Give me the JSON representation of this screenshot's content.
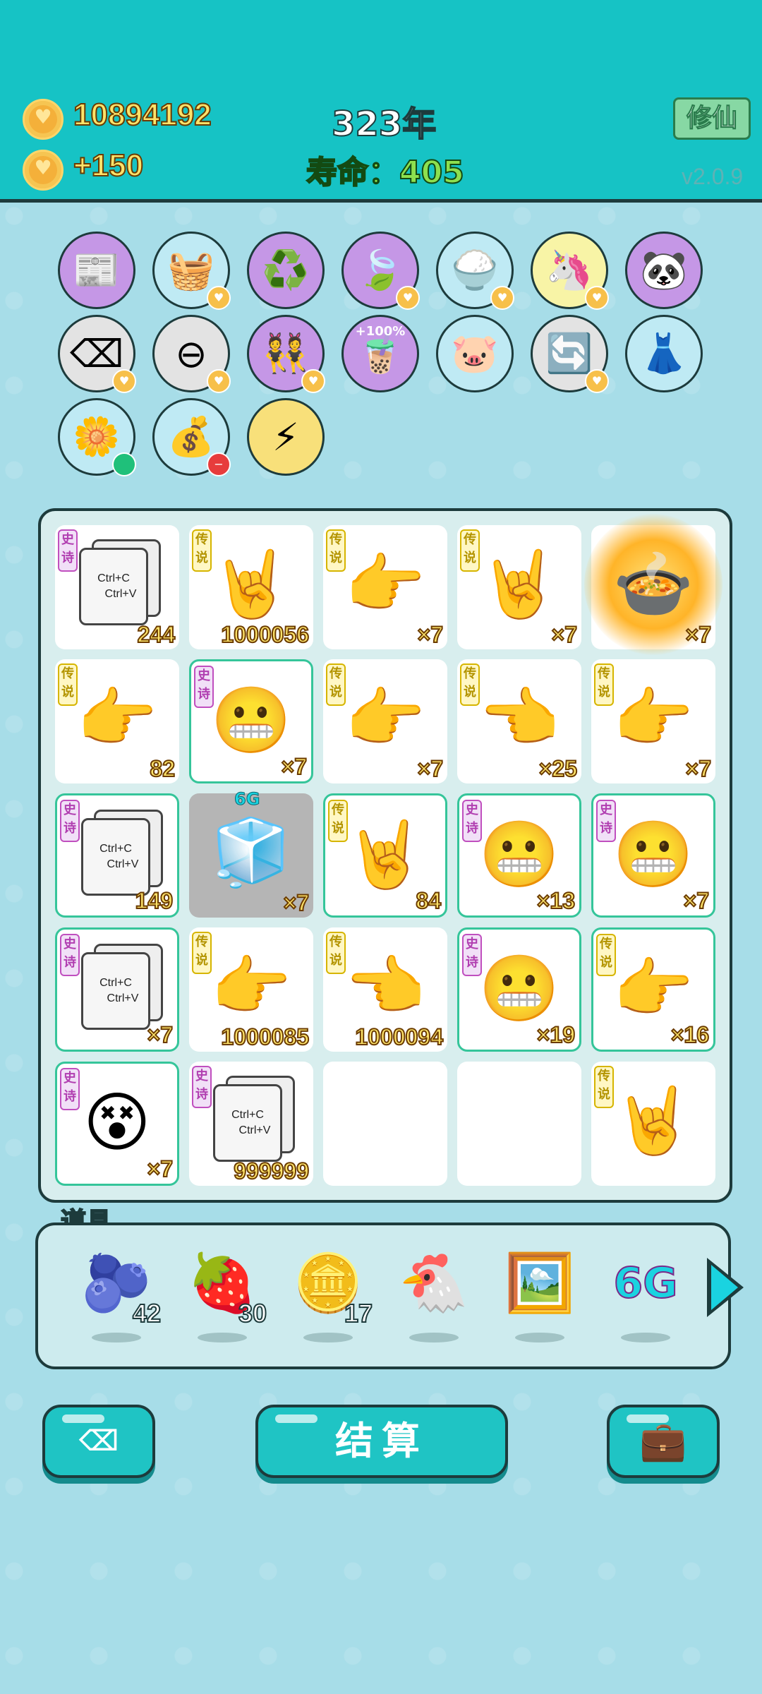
{
  "header": {
    "coins": "10894192",
    "coin_rate": "+150",
    "year": "323年",
    "lifespan": "寿命：405",
    "mode_button": "修仙",
    "version": "v2.0.9"
  },
  "buffs": [
    {
      "icon": "time-magazine-icon",
      "glyph": "📰",
      "bg": "purple",
      "mark": "none"
    },
    {
      "icon": "fruit-basket-icon",
      "glyph": "🧺",
      "bg": "blue",
      "mark": "heart"
    },
    {
      "icon": "recycle-icon",
      "glyph": "♻️",
      "bg": "purple",
      "mark": "none"
    },
    {
      "icon": "leaf-icon",
      "glyph": "🍃",
      "bg": "purple",
      "mark": "heart"
    },
    {
      "icon": "rice-bowl-icon",
      "glyph": "🍚",
      "bg": "blue",
      "mark": "heart"
    },
    {
      "icon": "unicorn-icon",
      "glyph": "🦄",
      "bg": "yellow",
      "mark": "heart"
    },
    {
      "icon": "panda-icon",
      "glyph": "🐼",
      "bg": "purple",
      "mark": "none"
    },
    {
      "icon": "delete-key-icon",
      "glyph": "⌫",
      "bg": "grey",
      "mark": "heart"
    },
    {
      "icon": "minus-circle-icon",
      "glyph": "⊖",
      "bg": "grey",
      "mark": "heart"
    },
    {
      "icon": "twins-icon",
      "glyph": "👯",
      "bg": "purple",
      "mark": "heart"
    },
    {
      "icon": "bubble-tea-icon",
      "glyph": "🧋",
      "bg": "purple",
      "mark": "none",
      "label": "+100%"
    },
    {
      "icon": "piggy-bank-icon",
      "glyph": "🐷",
      "bg": "blue",
      "mark": "none"
    },
    {
      "icon": "refresh-icon",
      "glyph": "🔄",
      "bg": "grey",
      "mark": "heart"
    },
    {
      "icon": "skirt-icon",
      "glyph": "👗",
      "bg": "blue",
      "mark": "none"
    },
    {
      "icon": "flower-pot-icon",
      "glyph": "🌼",
      "bg": "blue",
      "mark": "green"
    },
    {
      "icon": "money-bag-icon",
      "glyph": "💰",
      "bg": "blue",
      "mark": "red"
    },
    {
      "icon": "lightning-icon",
      "glyph": "⚡",
      "bg": "gold",
      "mark": "none"
    }
  ],
  "board": {
    "tag_epic": "史诗",
    "tag_legend": "传说",
    "cells": [
      {
        "type": "ctrlcv",
        "tag": "epic",
        "count": "244",
        "hl": false
      },
      {
        "type": "hand",
        "tag": "legend",
        "count": "1000056",
        "hl": false,
        "glyph": "🤘"
      },
      {
        "type": "hand",
        "tag": "legend",
        "count": "×7",
        "hl": false,
        "glyph": "👉"
      },
      {
        "type": "hand",
        "tag": "legend",
        "count": "×7",
        "hl": false,
        "glyph": "🤘"
      },
      {
        "type": "pot",
        "tag": "none",
        "count": "×7",
        "hl": false,
        "glyph": "🍲"
      },
      {
        "type": "hand",
        "tag": "legend",
        "count": "82",
        "hl": false,
        "glyph": "👉"
      },
      {
        "type": "face",
        "tag": "epic",
        "count": "×7",
        "hl": true,
        "glyph": "😬"
      },
      {
        "type": "hand",
        "tag": "legend",
        "count": "×7",
        "hl": false,
        "glyph": "👉"
      },
      {
        "type": "hand",
        "tag": "legend",
        "count": "×25",
        "hl": false,
        "glyph": "👈"
      },
      {
        "type": "hand",
        "tag": "legend",
        "count": "×7",
        "hl": false,
        "glyph": "👉"
      },
      {
        "type": "ctrlcv",
        "tag": "epic",
        "count": "149",
        "hl": true
      },
      {
        "type": "fridge",
        "tag": "none",
        "count": "×7",
        "hl": false,
        "glyph": "🧊",
        "label": "6G"
      },
      {
        "type": "hand",
        "tag": "legend",
        "count": "84",
        "hl": true,
        "glyph": "🤘"
      },
      {
        "type": "face",
        "tag": "epic",
        "count": "×13",
        "hl": true,
        "glyph": "😬"
      },
      {
        "type": "face",
        "tag": "epic",
        "count": "×7",
        "hl": true,
        "glyph": "😬"
      },
      {
        "type": "ctrlcv",
        "tag": "epic",
        "count": "×7",
        "hl": true
      },
      {
        "type": "hand",
        "tag": "legend",
        "count": "1000085",
        "hl": false,
        "glyph": "👉"
      },
      {
        "type": "hand",
        "tag": "legend",
        "count": "1000094",
        "hl": false,
        "glyph": "👈"
      },
      {
        "type": "face",
        "tag": "epic",
        "count": "×19",
        "hl": true,
        "glyph": "😬"
      },
      {
        "type": "hand",
        "tag": "legend",
        "count": "×16",
        "hl": true,
        "glyph": "👉"
      },
      {
        "type": "face",
        "tag": "epic",
        "count": "×7",
        "hl": true,
        "glyph": "😵"
      },
      {
        "type": "ctrlcv",
        "tag": "epic",
        "count": "999999",
        "hl": false
      },
      {
        "type": "empty",
        "tag": "none",
        "count": "",
        "hl": false
      },
      {
        "type": "empty",
        "tag": "none",
        "count": "",
        "hl": false
      },
      {
        "type": "hand",
        "tag": "legend",
        "count": "",
        "hl": false,
        "glyph": "🤘"
      }
    ],
    "ctrl_c": "Ctrl+C",
    "ctrl_v": "Ctrl+V"
  },
  "props": {
    "title": "道具",
    "items": [
      {
        "icon": "blueberry-icon",
        "glyph": "🫐",
        "count": "42"
      },
      {
        "icon": "strawberry-icon",
        "glyph": "🍓",
        "count": "30"
      },
      {
        "icon": "dollar-coin-icon",
        "glyph": "🪙",
        "count": "17"
      },
      {
        "icon": "chicken-icon",
        "glyph": "🐔",
        "count": ""
      },
      {
        "icon": "fridge-frame-icon",
        "glyph": "🖼️",
        "count": ""
      },
      {
        "icon": "6g-icon",
        "glyph": "6G",
        "count": ""
      }
    ]
  },
  "buttons": {
    "delete": "⌫",
    "settle": "结算",
    "bag": "💼"
  }
}
